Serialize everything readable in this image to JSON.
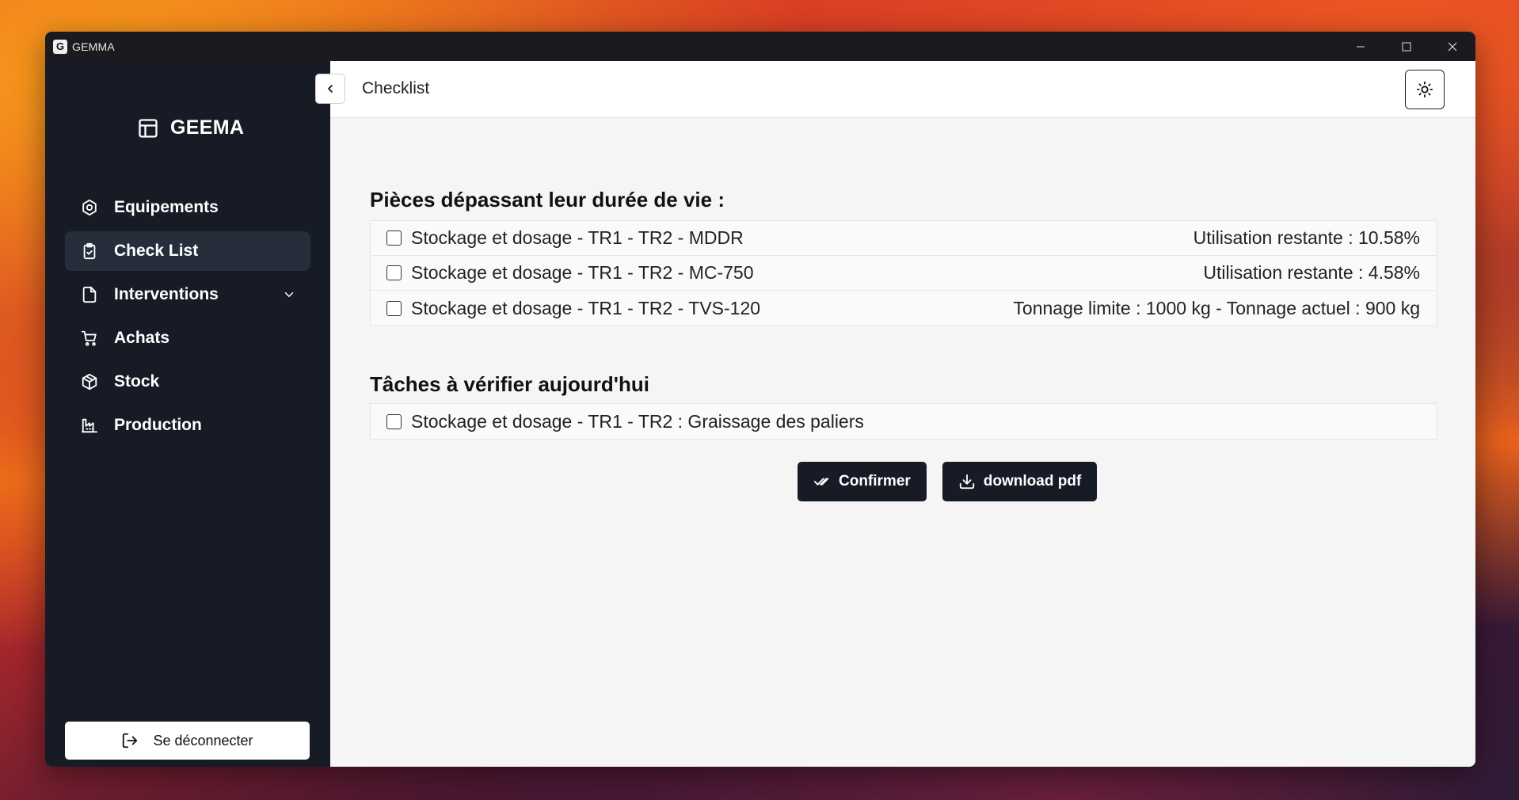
{
  "window": {
    "title": "GEMMA",
    "app_icon_letter": "G"
  },
  "brand": {
    "name": "GEEMA",
    "icon": "layout-icon"
  },
  "sidebar": {
    "items": [
      {
        "label": "Equipements",
        "icon": "cog-icon",
        "active": false
      },
      {
        "label": "Check List",
        "icon": "clipboard-check-icon",
        "active": true
      },
      {
        "label": "Interventions",
        "icon": "file-icon",
        "active": false,
        "has_submenu": true
      },
      {
        "label": "Achats",
        "icon": "cart-icon",
        "active": false
      },
      {
        "label": "Stock",
        "icon": "package-icon",
        "active": false
      },
      {
        "label": "Production",
        "icon": "factory-icon",
        "active": false
      }
    ],
    "logout_label": "Se déconnecter"
  },
  "header": {
    "title": "Checklist",
    "theme_icon": "sun-icon"
  },
  "sections": {
    "parts": {
      "title": "Pièces dépassant leur durée de vie :",
      "rows": [
        {
          "label": "Stockage et dosage - TR1 - TR2 - MDDR",
          "info": "Utilisation restante : 10.58%"
        },
        {
          "label": "Stockage et dosage - TR1 - TR2 - MC-750",
          "info": "Utilisation restante : 4.58%"
        },
        {
          "label": "Stockage et dosage - TR1 - TR2 - TVS-120",
          "info": "Tonnage limite : 1000 kg - Tonnage actuel : 900 kg"
        }
      ]
    },
    "tasks": {
      "title": "Tâches à vérifier aujourd'hui",
      "rows": [
        {
          "label": "Stockage et dosage - TR1 - TR2 : Graissage des paliers"
        }
      ]
    }
  },
  "actions": {
    "confirm_label": "Confirmer",
    "download_label": "download pdf"
  },
  "colors": {
    "sidebar_bg": "#161b26",
    "accent": "#161b26",
    "active_item_bg": "#262d3b"
  }
}
